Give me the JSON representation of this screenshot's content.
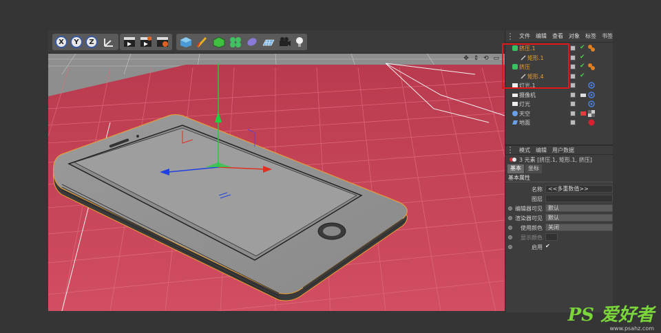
{
  "toolbar": {
    "axis_x": "X",
    "axis_y": "Y",
    "axis_z": "Z",
    "icons": [
      "x-axis-lock",
      "y-axis-lock",
      "z-axis-lock",
      "coordinate-system",
      "render-view",
      "render-picture",
      "render-settings",
      "cube-primitive",
      "pen-spline",
      "subdivision-generator",
      "array-cloner",
      "deformer",
      "floor-environment",
      "camera",
      "light"
    ]
  },
  "objects_panel": {
    "menu": [
      "文件",
      "编辑",
      "查看",
      "对象",
      "标签",
      "书签"
    ],
    "items": [
      {
        "name": "挤压.1",
        "icon": "extrude-icon",
        "highlight": true,
        "indent": 0
      },
      {
        "name": "矩形.1",
        "icon": "spline-icon",
        "highlight": true,
        "indent": 1
      },
      {
        "name": "挤压",
        "icon": "extrude-icon",
        "highlight": true,
        "indent": 0
      },
      {
        "name": "矩形.4",
        "icon": "spline-icon",
        "highlight": true,
        "indent": 1
      },
      {
        "name": "灯光.1",
        "icon": "light-icon",
        "highlight": false,
        "indent": 0
      },
      {
        "name": "摄像机",
        "icon": "camera-icon",
        "highlight": false,
        "indent": 0
      },
      {
        "name": "灯光",
        "icon": "light-icon",
        "highlight": false,
        "indent": 0
      },
      {
        "name": "天空",
        "icon": "sky-icon",
        "highlight": false,
        "indent": 0
      },
      {
        "name": "地面",
        "icon": "floor-icon",
        "highlight": false,
        "indent": 0
      }
    ]
  },
  "attributes_panel": {
    "menu": [
      "模式",
      "编辑",
      "用户数据"
    ],
    "selection_info": "3 元素 [挤压.1, 矩形.1, 挤压]",
    "tabs": [
      "基本",
      "坐标"
    ],
    "section_title": "基本属性",
    "props": [
      {
        "label": "名称",
        "value": "<<多重数值>>",
        "dim": false
      },
      {
        "label": "图层",
        "value": "",
        "dim": false
      },
      {
        "label": "编辑器可见",
        "value": "默认",
        "dim": false
      },
      {
        "label": "渲染器可见",
        "value": "默认",
        "dim": false
      },
      {
        "label": "使用颜色",
        "value": "关闭",
        "dim": false
      },
      {
        "label": "显示颜色",
        "value": "",
        "dim": true
      },
      {
        "label": "启用",
        "value": "✔",
        "dim": false
      }
    ]
  },
  "watermark": {
    "main": "PS 爱好者",
    "sub": "www.psahz.com"
  },
  "colors": {
    "floor": "#c5485a",
    "highlight_text": "#f0a030",
    "selection_box": "#e01818",
    "axis_green": "#20d040",
    "axis_red": "#e03020",
    "axis_blue": "#2040e0"
  }
}
